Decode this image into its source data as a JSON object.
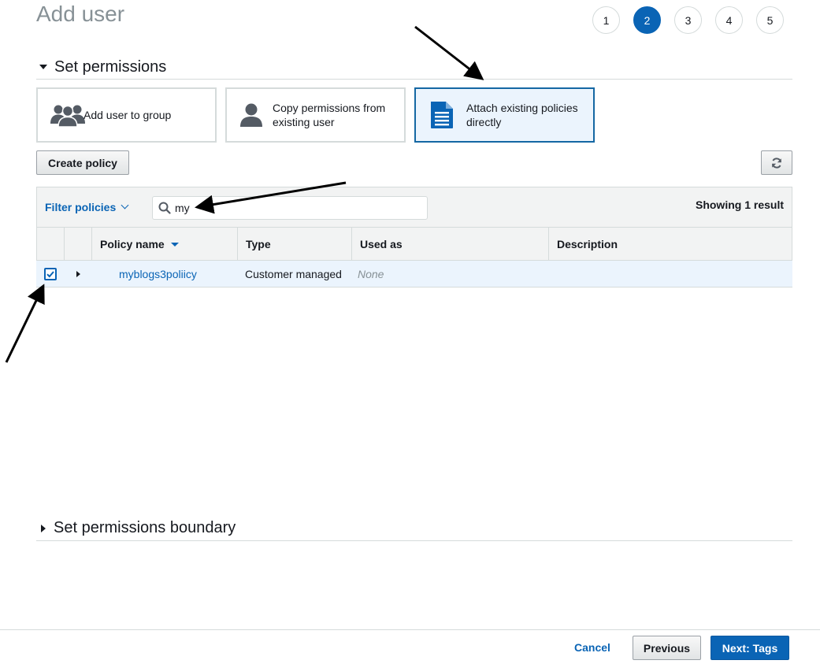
{
  "page": {
    "title": "Add user"
  },
  "steps": [
    "1",
    "2",
    "3",
    "4",
    "5"
  ],
  "active_step": "2",
  "permissions": {
    "heading": "Set permissions",
    "options": [
      {
        "label": "Add user to group",
        "icon": "group-icon"
      },
      {
        "label": "Copy permissions from existing user",
        "icon": "user-icon"
      },
      {
        "label": "Attach existing policies directly",
        "icon": "document-icon",
        "selected": true
      }
    ]
  },
  "toolbar": {
    "create_policy_label": "Create policy",
    "refresh_icon": "refresh-icon"
  },
  "filter": {
    "dropdown_label": "Filter policies",
    "search_value": "my",
    "result_text": "Showing 1 result"
  },
  "table": {
    "headers": [
      "Policy name",
      "Type",
      "Used as",
      "Description"
    ],
    "rows": [
      {
        "checked": true,
        "policy_name": "myblogs3poliicy",
        "type": "Customer managed",
        "used_as": "None",
        "description": ""
      }
    ]
  },
  "boundary": {
    "heading": "Set permissions boundary"
  },
  "footer": {
    "cancel_label": "Cancel",
    "previous_label": "Previous",
    "next_label": "Next: Tags"
  },
  "colors": {
    "accent": "#0a64b5",
    "selected_bg": "#ebf4fd",
    "border": "#d5dbdb",
    "muted": "#879196"
  }
}
